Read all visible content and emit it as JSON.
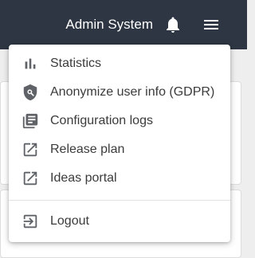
{
  "topbar": {
    "title": "Admin System",
    "bell_icon": "bell-icon",
    "menu_icon": "hamburger-menu-icon",
    "background_color": "#2d3642"
  },
  "dropdown": {
    "items": [
      {
        "label": "Statistics",
        "icon": "bar-chart-icon"
      },
      {
        "label": "Anonymize user info (GDPR)",
        "icon": "shield-search-icon"
      },
      {
        "label": "Configuration logs",
        "icon": "library-books-icon"
      },
      {
        "label": "Release plan",
        "icon": "open-in-new-icon"
      },
      {
        "label": "Ideas portal",
        "icon": "open-in-new-icon"
      }
    ],
    "logout": {
      "label": "Logout",
      "icon": "logout-icon"
    }
  }
}
